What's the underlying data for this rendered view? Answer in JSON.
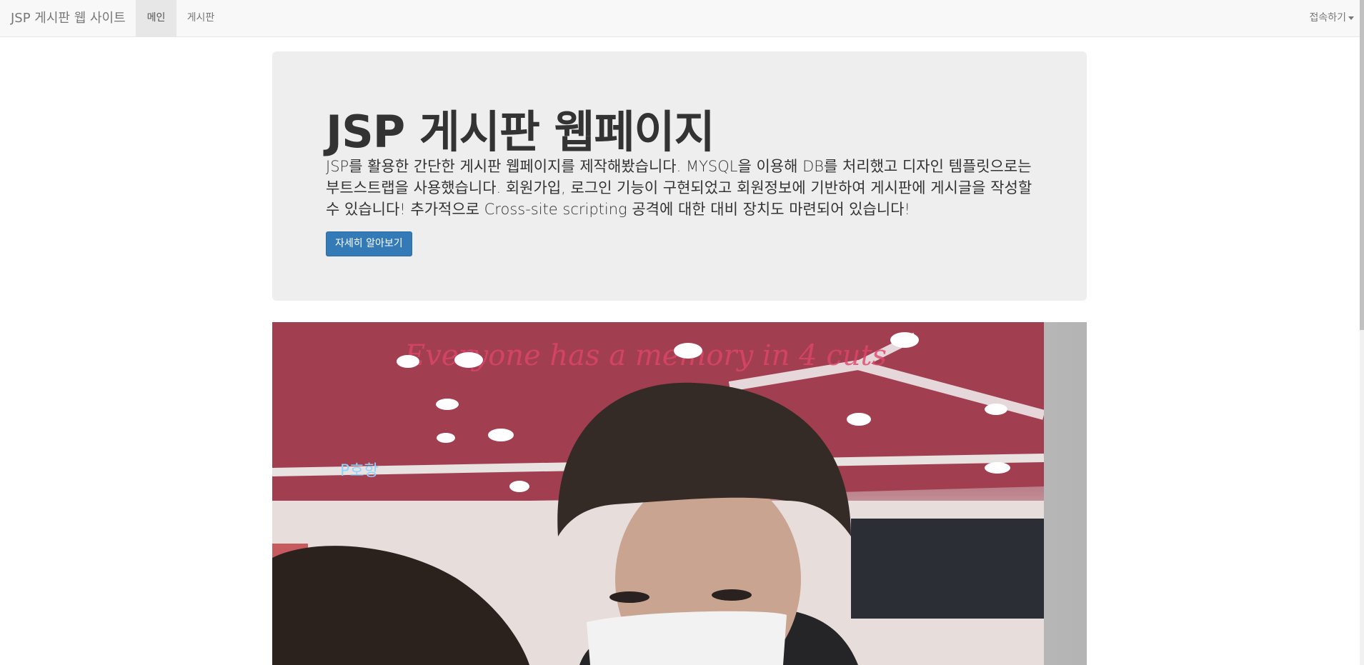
{
  "navbar": {
    "brand": "JSP 게시판 웹 사이트",
    "items": [
      {
        "label": "메인",
        "active": true
      },
      {
        "label": "게시판",
        "active": false
      }
    ],
    "right_dropdown": "접속하기"
  },
  "jumbotron": {
    "title": "JSP 게시판 웹페이지",
    "description": "JSP를 활용한 간단한 게시판 웹페이지를 제작해봤습니다. MYSQL을 이용해 DB를 처리했고 디자인 템플릿으로는 부트스트랩을 사용했습니다. 회원가입, 로그인 기능이 구현되었고 회원정보에 기반하여 게시판에 게시글을 작성할 수 있습니다! 추가적으로 Cross-site scripting 공격에 대한 대비 장치도 마련되어 있습니다!",
    "button_label": "자세히 알아보기"
  },
  "photo": {
    "neon_sign": "Everyone has a memory in 4 cuts",
    "window_sign": "P호항"
  },
  "colors": {
    "primary": "#337ab7",
    "navbar_bg": "#f8f8f8",
    "jumbotron_bg": "#eeeeee"
  }
}
